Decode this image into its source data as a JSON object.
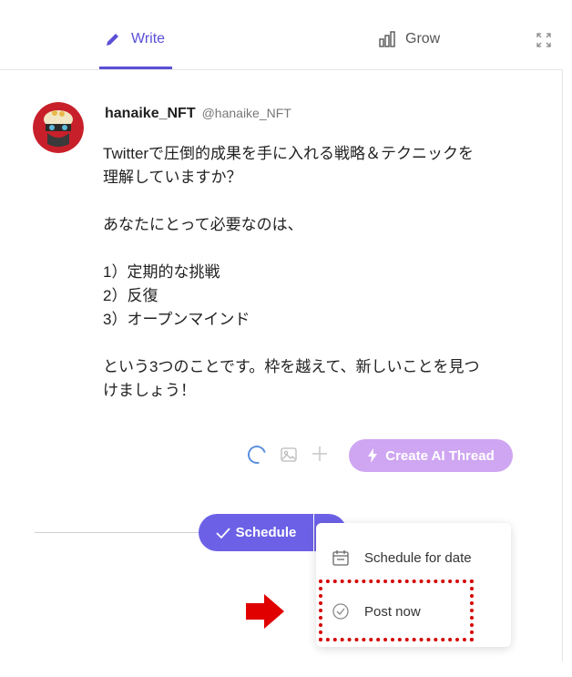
{
  "tabs": [
    {
      "label": "Write",
      "icon": "pencil-icon",
      "active": true
    },
    {
      "label": "Grow",
      "icon": "bar-chart-icon",
      "active": false
    }
  ],
  "post": {
    "author_name": "hanaike_NFT",
    "author_handle": "@hanaike_NFT",
    "body": "Twitterで圧倒的成果を手に入れる戦略＆テクニックを\n理解していますか？\n\nあなたにとって必要なのは、\n\n1）定期的な挑戦\n2）反復\n3）オープンマインド\n\nという3つのことです。枠を越えて、新しいことを見つ\nけましょう！"
  },
  "toolbar": {
    "ai_button_label": "Create AI Thread"
  },
  "schedule": {
    "button_label": "Schedule"
  },
  "dropdown": {
    "items": [
      {
        "label": "Schedule for date",
        "icon": "calendar-icon"
      },
      {
        "label": "Post now",
        "icon": "check-circle-icon"
      }
    ]
  },
  "colors": {
    "accent": "#5a4fd6",
    "schedule_button": "#6c61e6",
    "ai_button": "#cfa6f2",
    "annotation": "#d40000"
  }
}
